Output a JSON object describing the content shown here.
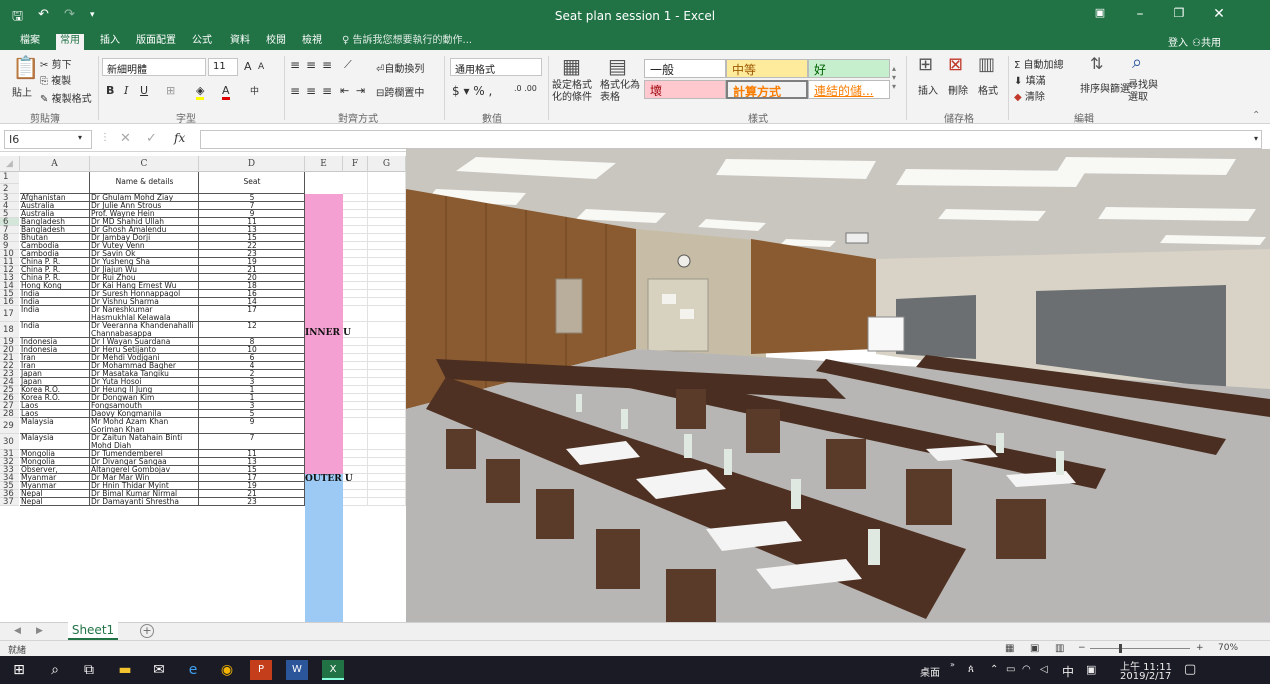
{
  "window": {
    "title": "Seat plan session 1 - Excel",
    "qa_save": "🖫",
    "qa_undo": "↶",
    "qa_redo": "↷"
  },
  "tabs": [
    "檔案",
    "常用",
    "插入",
    "版面配置",
    "公式",
    "資料",
    "校閱",
    "檢視"
  ],
  "tell_me": "告訴我您想要執行的動作...",
  "account": {
    "signin": "登入",
    "share": "共用"
  },
  "ribbon": {
    "clipboard": {
      "cut": "剪下",
      "copy": "複製",
      "format_painter": "複製格式",
      "paste": "貼上",
      "group": "剪貼簿"
    },
    "font": {
      "name": "新細明體",
      "size": "11",
      "group": "字型"
    },
    "alignment": {
      "wrap": "自動換列",
      "merge": "跨欄置中",
      "group": "對齊方式"
    },
    "number": {
      "format": "通用格式",
      "group": "數值"
    },
    "styles": {
      "conditional": "設定格式化的條件",
      "as_table": "格式化為表格",
      "normal": "一般",
      "neutral": "中等",
      "good": "好",
      "bad": "壞",
      "calculation": "計算方式",
      "linked": "連結的儲...",
      "group": "樣式"
    },
    "cells": {
      "insert": "插入",
      "delete": "刪除",
      "format": "格式",
      "group": "儲存格"
    },
    "editing": {
      "autosum": "自動加總",
      "fill": "填滿",
      "clear": "清除",
      "sort": "排序與篩選",
      "find": "尋找與選取",
      "group": "編輯"
    }
  },
  "namebox": "I6",
  "columns": [
    "A",
    "C",
    "D",
    "E",
    "F",
    "G"
  ],
  "header_row": {
    "c": "Name & details",
    "d": "Seat"
  },
  "rows": [
    {
      "n": "3",
      "a": "Afghanistan",
      "c": "Dr Ghulam Mohd Ziay",
      "d": "5"
    },
    {
      "n": "4",
      "a": "Australia",
      "c": "Dr Julie Ann Strous",
      "d": "7"
    },
    {
      "n": "5",
      "a": "Australia",
      "c": "Prof. Wayne Hein",
      "d": "9"
    },
    {
      "n": "6",
      "a": "Bangladesh",
      "c": "Dr MD Shahid Ullah",
      "d": "11"
    },
    {
      "n": "7",
      "a": "Bangladesh",
      "c": "Dr Ghosh Amalendu",
      "d": "13"
    },
    {
      "n": "8",
      "a": "Bhutan",
      "c": "Dr Jambay Dorji",
      "d": "15"
    },
    {
      "n": "9",
      "a": "Cambodia",
      "c": "Dr Vutey Venn",
      "d": "22"
    },
    {
      "n": "10",
      "a": "Cambodia",
      "c": "Dr Savin Ok",
      "d": "23"
    },
    {
      "n": "11",
      "a": "China P. R.",
      "c": "Dr Yusheng Sha",
      "d": "19"
    },
    {
      "n": "12",
      "a": "China P. R.",
      "c": "Dr Jiajun Wu",
      "d": "21"
    },
    {
      "n": "13",
      "a": "China P. R.",
      "c": "Dr Rui Zhou",
      "d": "20"
    },
    {
      "n": "14",
      "a": "Hong Kong",
      "c": "Dr Kai Hang Ernest Wu",
      "d": "18"
    },
    {
      "n": "15",
      "a": "India",
      "c": "Dr Suresh Honnappagol",
      "d": "16"
    },
    {
      "n": "16",
      "a": "India",
      "c": "Dr Vishnu Sharma",
      "d": "14"
    },
    {
      "n": "17",
      "a": "India",
      "c": "Dr Nareshkumar Hasmukhlal Kelawala",
      "d": "17",
      "tall": true
    },
    {
      "n": "18",
      "a": "India",
      "c": "Dr Veeranna Khandenahalli Channabasappa",
      "d": "12",
      "tall": true
    },
    {
      "n": "19",
      "a": "Indonesia",
      "c": "Dr I Wayan Suardana",
      "d": "8"
    },
    {
      "n": "20",
      "a": "Indonesia",
      "c": "Dr Heru Setijanto",
      "d": "10"
    },
    {
      "n": "21",
      "a": "Iran",
      "c": "Dr Mehdi Vodjgani",
      "d": "6"
    },
    {
      "n": "22",
      "a": "Iran",
      "c": "Dr Mohammad Bagher",
      "d": "4"
    },
    {
      "n": "23",
      "a": "Japan",
      "c": "Dr Masataka Tangiku",
      "d": "2"
    },
    {
      "n": "24",
      "a": "Japan",
      "c": "Dr Yuta Hosoi",
      "d": "3"
    },
    {
      "n": "25",
      "a": "Korea R.O.",
      "c": "Dr Heung Il Jung",
      "d": "1"
    },
    {
      "n": "26",
      "a": "Korea R.O.",
      "c": "Dr Dongwan Kim",
      "d": "1"
    },
    {
      "n": "27",
      "a": "Laos",
      "c": "Fongsamouth",
      "d": "3"
    },
    {
      "n": "28",
      "a": "Laos",
      "c": "Daovy Kongmanila",
      "d": "5"
    },
    {
      "n": "29",
      "a": "Malaysia",
      "c": "Mr Mohd Azam Khan Goriman Khan",
      "d": "9",
      "tall": true
    },
    {
      "n": "30",
      "a": "Malaysia",
      "c": "Dr Zaitun Natahain Binti Mohd Diah",
      "d": "7",
      "tall": true
    },
    {
      "n": "31",
      "a": "Mongolia",
      "c": "Dr Tumendemberel Dorjnyam",
      "d": "11"
    },
    {
      "n": "32",
      "a": "Mongolia",
      "c": "Dr Divangar Sangaa",
      "d": "13"
    },
    {
      "n": "33",
      "a": "Observer, Mongolia",
      "c": "Altangerel Gombojav",
      "d": "15"
    },
    {
      "n": "34",
      "a": "Myanmar",
      "c": "Dr Mar Mar Win",
      "d": "17"
    },
    {
      "n": "35",
      "a": "Myanmar",
      "c": "Dr Hnin Thidar Myint",
      "d": "19"
    },
    {
      "n": "36",
      "a": "Nepal",
      "c": "Dr Bimal Kumar Nirmal",
      "d": "21"
    },
    {
      "n": "37",
      "a": "Nepal",
      "c": "Dr Damayanti Shrestha",
      "d": "23"
    }
  ],
  "blocks": {
    "inner": "INNER U",
    "outer": "OUTER U"
  },
  "sheet_tab": "Sheet1",
  "status": {
    "ready": "就緒",
    "zoom": "70%"
  },
  "tray": {
    "desktop": "桌面",
    "ime": "中",
    "time": "上午 11:11",
    "date": "2019/2/17"
  },
  "colors": {
    "accent": "#217346",
    "inner": "#f5a0d2",
    "outer": "#9ccaf4"
  }
}
